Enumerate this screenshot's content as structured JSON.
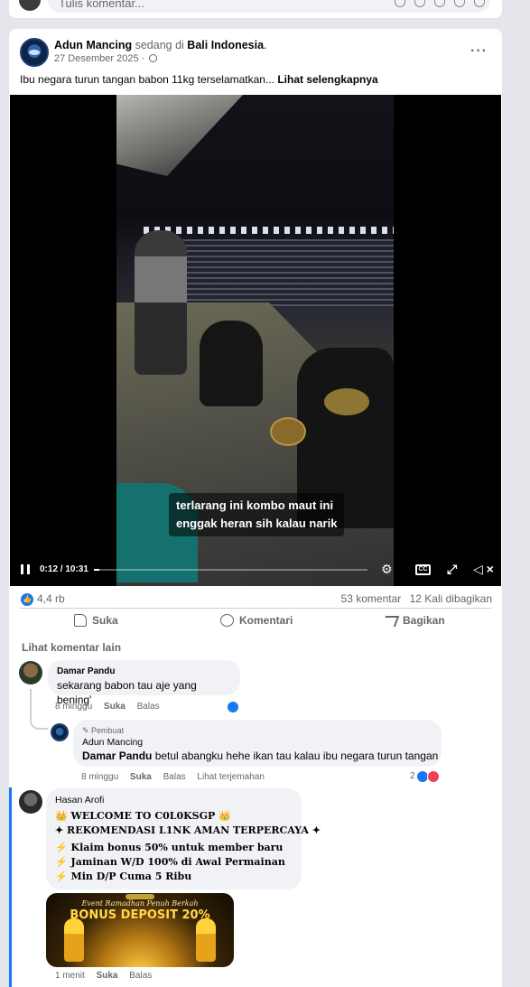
{
  "top_fragment": {
    "placeholder": "Tulis komentar..."
  },
  "post": {
    "author": "Adun Mancing",
    "location_prefix": "sedang di",
    "location": "Bali Indonesia",
    "date": "27 Desember 2025",
    "text": "Ibu negara turun tangan babon 11kg terselamatkan...",
    "see_more": "Lihat selengkapnya"
  },
  "video": {
    "subtitle_line1": "terlarang ini kombo maut ini",
    "subtitle_line2": "enggak heran sih kalau narik",
    "time": "0:12 / 10:31",
    "progress": 0.019,
    "cc_label": "CC"
  },
  "stats": {
    "reactions": "4,4 rb",
    "comments": "53 komentar",
    "shares": "12 Kali dibagikan"
  },
  "actions": {
    "like": "Suka",
    "comment": "Komentari",
    "share": "Bagikan"
  },
  "see_more_comments": "Lihat komentar lain",
  "comments": [
    {
      "name": "Damar Pandu",
      "text": "sekarang babon tau aje yang bening'",
      "time": "8 minggu",
      "like": "Suka",
      "reply": "Balas"
    },
    {
      "badge": "Pembuat",
      "name": "Adun Mancing",
      "mention": "Damar Pandu",
      "text": "betul abangku hehe ikan tau kalau ibu negara turun tangan",
      "time": "8 minggu",
      "like": "Suka",
      "reply": "Balas",
      "translate": "Lihat terjemahan",
      "reaction_count": "2"
    },
    {
      "name": "Hasan Arofi",
      "line1": "👑 WELCOME TO C0L0KSGP 👑",
      "line2": "✦ REKOMENDASI L1NK AMAN TERPERCAYA ✦",
      "line3": "Klaim bonus 50% untuk member baru",
      "line4": "Jaminan W/D 100% di Awal Permainan",
      "line5": "Min D/P Cuma 5 Ribu",
      "bolt": "⚡",
      "time": "1 menit",
      "like": "Suka",
      "reply": "Balas"
    }
  ],
  "promo_image": {
    "line1": "Event Ramadhan Penuh Berkah",
    "line2": "BONUS DEPOSIT 20%"
  }
}
